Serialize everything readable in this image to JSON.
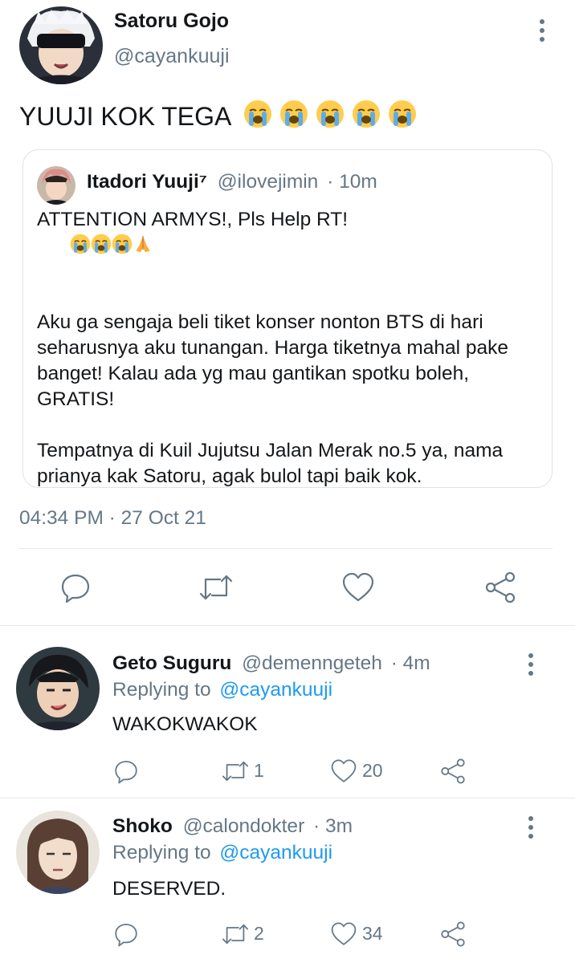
{
  "main_tweet": {
    "author_name": "Satoru Gojo",
    "author_handle": "@cayankuuji",
    "text": "YUUJI KOK TEGA",
    "emoji_count": 5,
    "timestamp": "04:34 PM · 27 Oct 21",
    "actions": [
      "reply-icon",
      "retweet-icon",
      "like-icon",
      "share-icon"
    ]
  },
  "quoted_tweet": {
    "author_name": "Itadori Yuuji⁷",
    "author_handle": "@ilovejimin",
    "time": "· 10m",
    "line1": "ATTENTION ARMYS!, Pls Help RT!",
    "para2": "Aku ga sengaja beli tiket konser nonton BTS di hari seharusnya aku tunangan. Harga tiketnya mahal pake banget! Kalau ada yg mau gantikan spotku boleh, GRATIS!",
    "para3": "Tempatnya di Kuil Jujutsu Jalan Merak no.5 ya, nama prianya kak Satoru, agak bulol tapi baik kok."
  },
  "replies": [
    {
      "author_name": "Geto Suguru",
      "author_handle": "@demenngeteh",
      "time": "· 4m",
      "replying_prefix": "Replying to",
      "replying_to": "@cayankuuji",
      "text": "WAKOKWAKOK",
      "retweets": "1",
      "likes": "20"
    },
    {
      "author_name": "Shoko",
      "author_handle": "@calondokter",
      "time": "· 3m",
      "replying_prefix": "Replying to",
      "replying_to": "@cayankuuji",
      "text": "DESERVED.",
      "retweets": "2",
      "likes": "34"
    }
  ],
  "colors": {
    "link": "#1d9bf0",
    "muted": "#657786",
    "divider": "#e1e8ed"
  }
}
